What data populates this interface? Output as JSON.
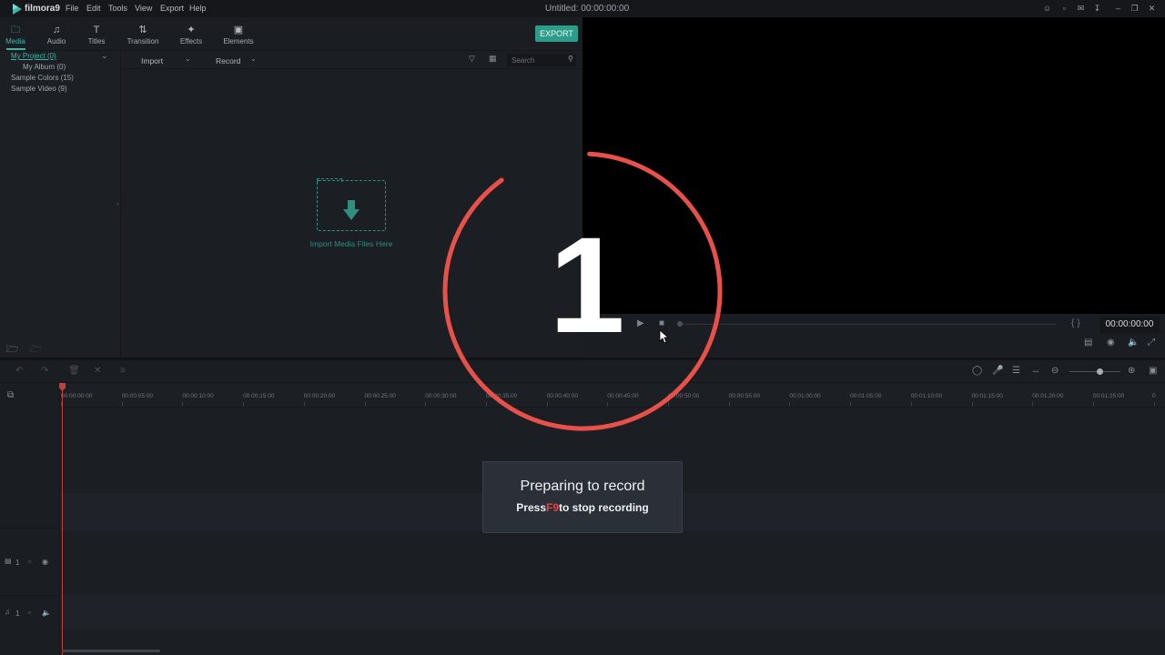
{
  "app": {
    "logo_text": "filmora9",
    "window_title": "Untitled: 00:00:00:00",
    "menu": [
      "File",
      "Edit",
      "Tools",
      "View",
      "Export",
      "Help"
    ]
  },
  "window_icons": [
    "user-icon",
    "lock-icon",
    "mail-icon",
    "download-icon",
    "minimize-icon",
    "restore-icon",
    "close-icon"
  ],
  "tabs": [
    {
      "label": "Media",
      "icon": "folder-icon",
      "active": true
    },
    {
      "label": "Audio",
      "icon": "music-note-icon",
      "active": false
    },
    {
      "label": "Titles",
      "icon": "text-t-icon",
      "active": false
    },
    {
      "label": "Transition",
      "icon": "transition-icon",
      "active": false
    },
    {
      "label": "Effects",
      "icon": "effects-icon",
      "active": false
    },
    {
      "label": "Elements",
      "icon": "image-icon",
      "active": false
    }
  ],
  "export_label": "EXPORT",
  "tree": {
    "items": [
      {
        "label": "My Project (0)",
        "selected": true
      },
      {
        "label": "My Album (0)",
        "selected": false
      },
      {
        "label": "Sample Colors (15)",
        "selected": false
      },
      {
        "label": "Sample Video (9)",
        "selected": false
      }
    ]
  },
  "media_toolbar": {
    "import_label": "Import",
    "record_label": "Record",
    "search_placeholder": "Search"
  },
  "import_area": {
    "label": "Import Media Files Here"
  },
  "preview": {
    "timecode": "00:00:00:00"
  },
  "timeline": {
    "ruler_labels": [
      "00:00:00:00",
      "00:00:05:00",
      "00:00:10:00",
      "00:00:15:00",
      "00:00:20:00",
      "00:00:25:00",
      "00:00:30:00",
      "00:00:35:00",
      "00:00:40:00",
      "00:00:45:00",
      "00:00:50:00",
      "00:00:55:00",
      "00:01:00:00",
      "00:01:05:00",
      "00:01:10:00",
      "00:01:15:00",
      "00:01:20:00",
      "00:01:25:00",
      "0"
    ],
    "video_track": {
      "number": "1"
    },
    "audio_track": {
      "number": "1"
    }
  },
  "countdown": {
    "number": "1",
    "ring_color": "#e8514a"
  },
  "toast": {
    "title": "Preparing to record",
    "press_word": "Press",
    "key": "F9",
    "suffix": "to stop recording"
  },
  "colors": {
    "accent": "#3fb5a6",
    "export_bg": "#2e9c8a",
    "playhead": "#c2413b",
    "key_highlight": "#e0463f"
  }
}
